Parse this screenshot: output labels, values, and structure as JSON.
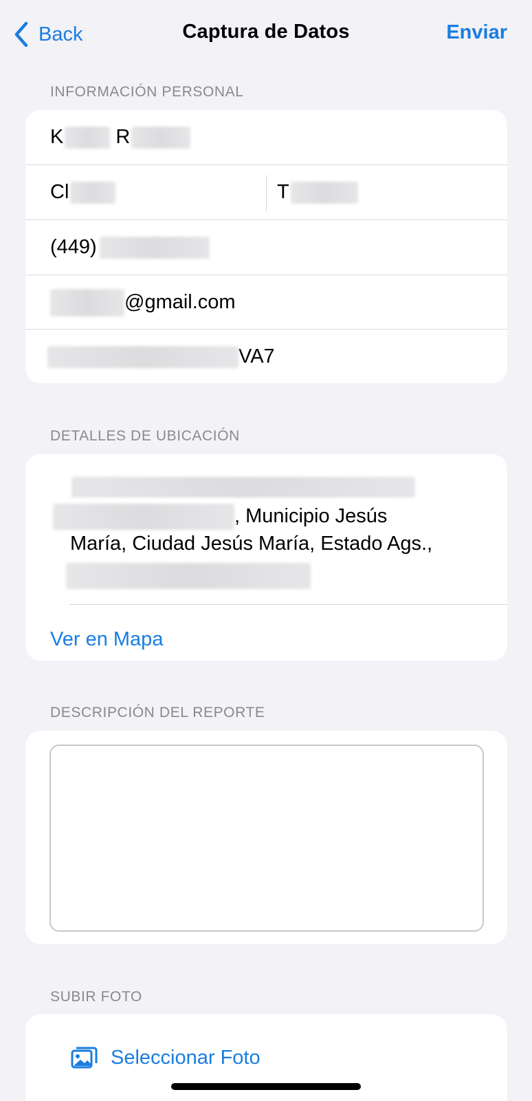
{
  "nav": {
    "back_label": "Back",
    "title": "Captura de Datos",
    "send_label": "Enviar"
  },
  "personal": {
    "header": "INFORMACIÓN PERSONAL",
    "name_prefix": "K",
    "name_mid": "R",
    "first_prefix": "Cl",
    "last_prefix": "T",
    "phone_prefix": "(449)",
    "email_suffix": "@gmail.com",
    "id_suffix": "VA7"
  },
  "location": {
    "header": "DETALLES DE UBICACIÓN",
    "address_line2": ", Municipio Jesús",
    "address_line3": "María, Ciudad Jesús María, Estado Ags.,",
    "map_label": "Ver en Mapa"
  },
  "report": {
    "header": "DESCRIPCIÓN DEL REPORTE",
    "value": ""
  },
  "photo": {
    "header": "SUBIR FOTO",
    "select_label": "Seleccionar Foto"
  },
  "icons": {
    "back": "chevron-left-icon",
    "photo": "photo-library-icon"
  },
  "colors": {
    "accent": "#1a7de0",
    "background": "#f2f2f7",
    "card": "#ffffff",
    "secondary_text": "#8a8a8e"
  }
}
